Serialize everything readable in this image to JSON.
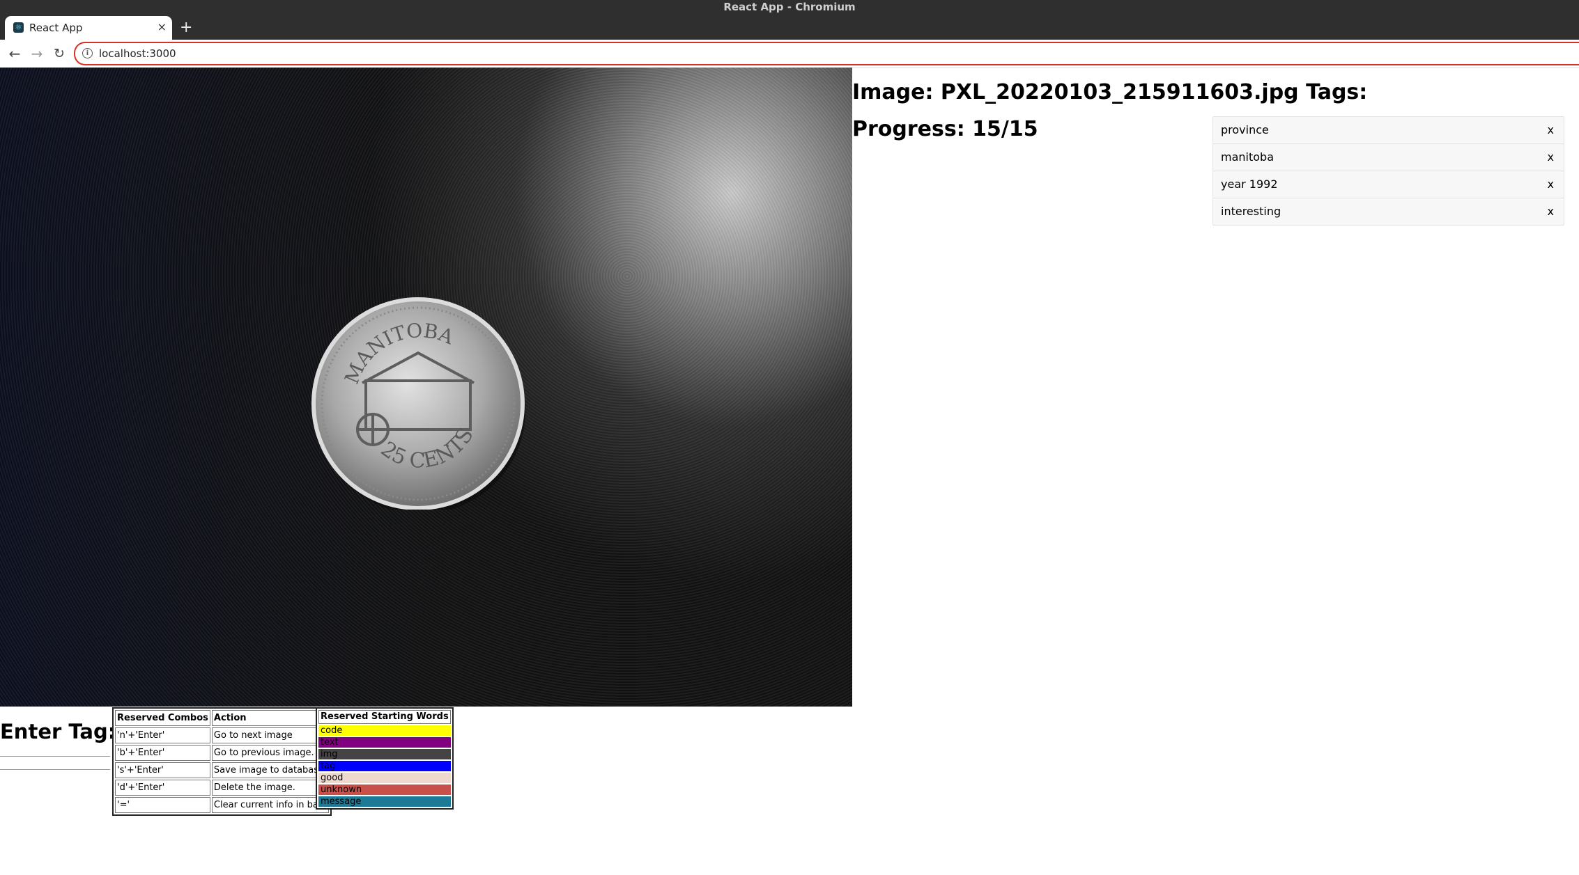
{
  "window": {
    "title": "React App - Chromium"
  },
  "tab": {
    "title": "React App",
    "close": "×",
    "new_tab": "+"
  },
  "toolbar": {
    "url": "localhost:3000"
  },
  "photo": {
    "coin_top_text": "MANITOBA",
    "coin_bottom_text": "25 CENTS"
  },
  "info": {
    "image_label": "Image: PXL_20220103_215911603.jpg",
    "tags_label": "Tags:",
    "progress_label": "Progress: 15/15"
  },
  "tags": [
    {
      "label": "province",
      "remove": "x"
    },
    {
      "label": "manitoba",
      "remove": "x"
    },
    {
      "label": "year 1992",
      "remove": "x"
    },
    {
      "label": "interesting",
      "remove": "x"
    }
  ],
  "enter_tag": {
    "label": "Enter Tag:",
    "value": ""
  },
  "combos": {
    "headers": [
      "Reserved Combos",
      "Action"
    ],
    "rows": [
      [
        "'n'+'Enter'",
        "Go to next image"
      ],
      [
        "'b'+'Enter'",
        "Go to previous image."
      ],
      [
        "'s'+'Enter'",
        "Save image to database."
      ],
      [
        "'d'+'Enter'",
        "Delete the image."
      ],
      [
        "'='",
        "Clear current info in bar"
      ]
    ]
  },
  "reserved_words": {
    "header": "Reserved Starting Words",
    "items": [
      {
        "word": "code",
        "color": "#ffff00"
      },
      {
        "word": "text",
        "color": "#800080"
      },
      {
        "word": "img",
        "color": "#444444"
      },
      {
        "word": "tag",
        "color": "#0000ff"
      },
      {
        "word": "good",
        "color": "#eed9cf"
      },
      {
        "word": "unknown",
        "color": "#c9504a"
      },
      {
        "word": "message",
        "color": "#1d7a96"
      }
    ]
  }
}
